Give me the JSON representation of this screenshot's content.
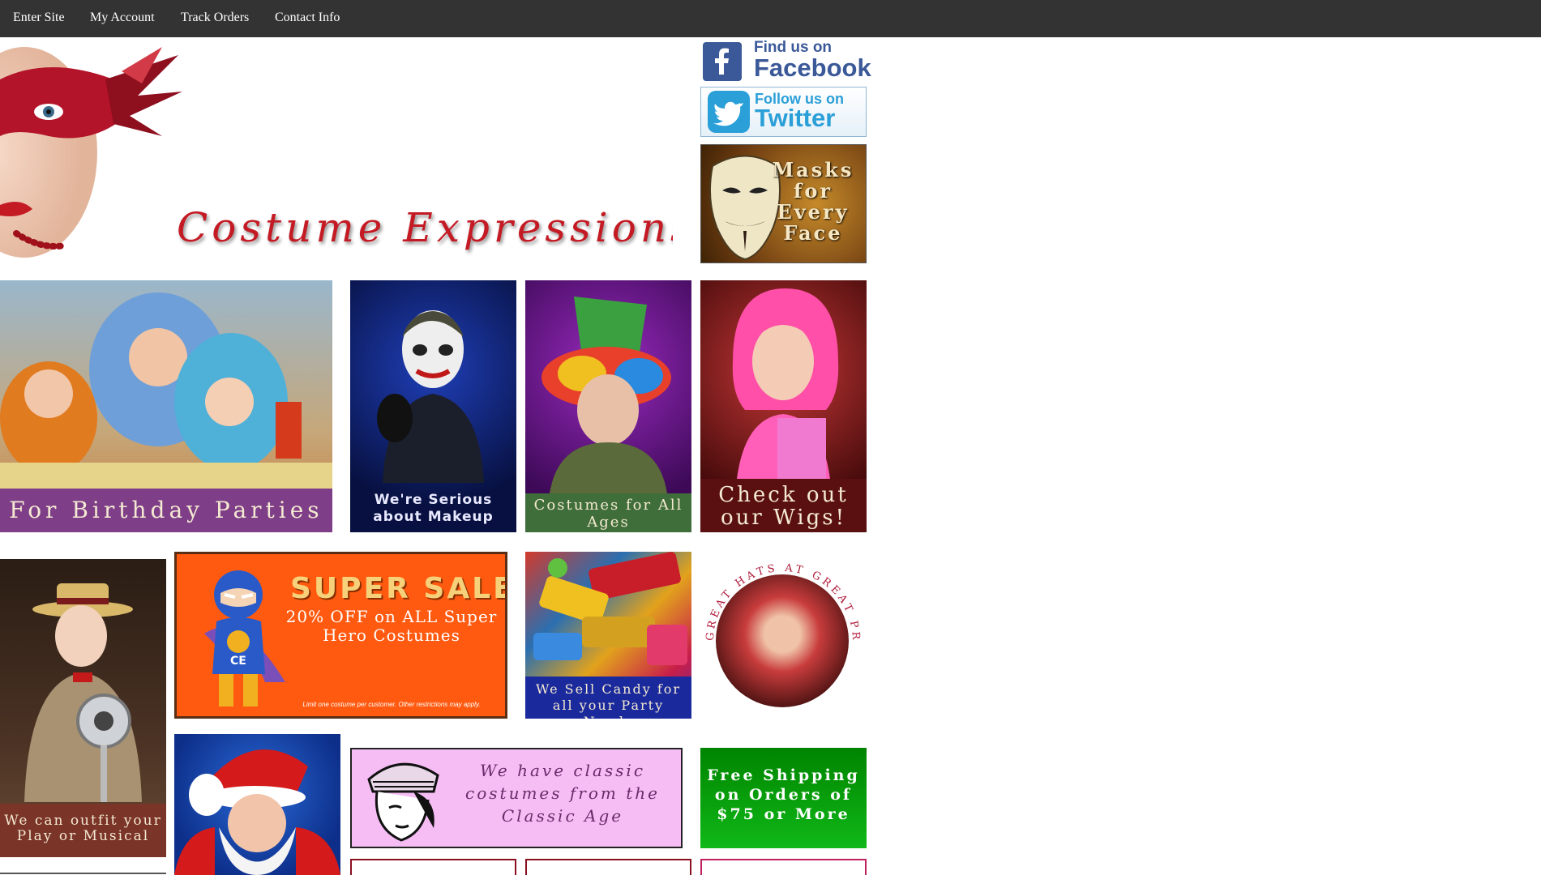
{
  "nav": {
    "items": [
      "Enter Site",
      "My Account",
      "Track Orders",
      "Contact Info"
    ]
  },
  "header": {
    "brand": "Costume Expressions"
  },
  "social": {
    "facebook_line1": "Find us on",
    "facebook_line2": "Facebook",
    "twitter_line1": "Follow us on",
    "twitter_line2": "Twitter"
  },
  "promos": {
    "masks": "Masks for Every Face",
    "birthday": "For Birthday Parties",
    "makeup": "We're Serious about Makeup",
    "ages": "Costumes for All Ages",
    "wigs": "Check out our Wigs!",
    "musical": "We can outfit your Play or Musical",
    "sale_title": "SUPER SALE",
    "sale_sub": "20% OFF on ALL Super Hero Costumes",
    "sale_fine": "Limit one costume per customer. Other restrictions may apply.",
    "candy": "We Sell Candy for all your Party Needs",
    "hats": "GREAT HATS AT GREAT PRICES",
    "classic": "We have classic costumes from the Classic Age",
    "shipping": "Free Shipping on Orders of $75 or More"
  },
  "colors": {
    "nav_bg": "#333333",
    "brand_red": "#c41a24",
    "facebook_blue": "#3b5998",
    "twitter_blue": "#2b9fd8"
  }
}
